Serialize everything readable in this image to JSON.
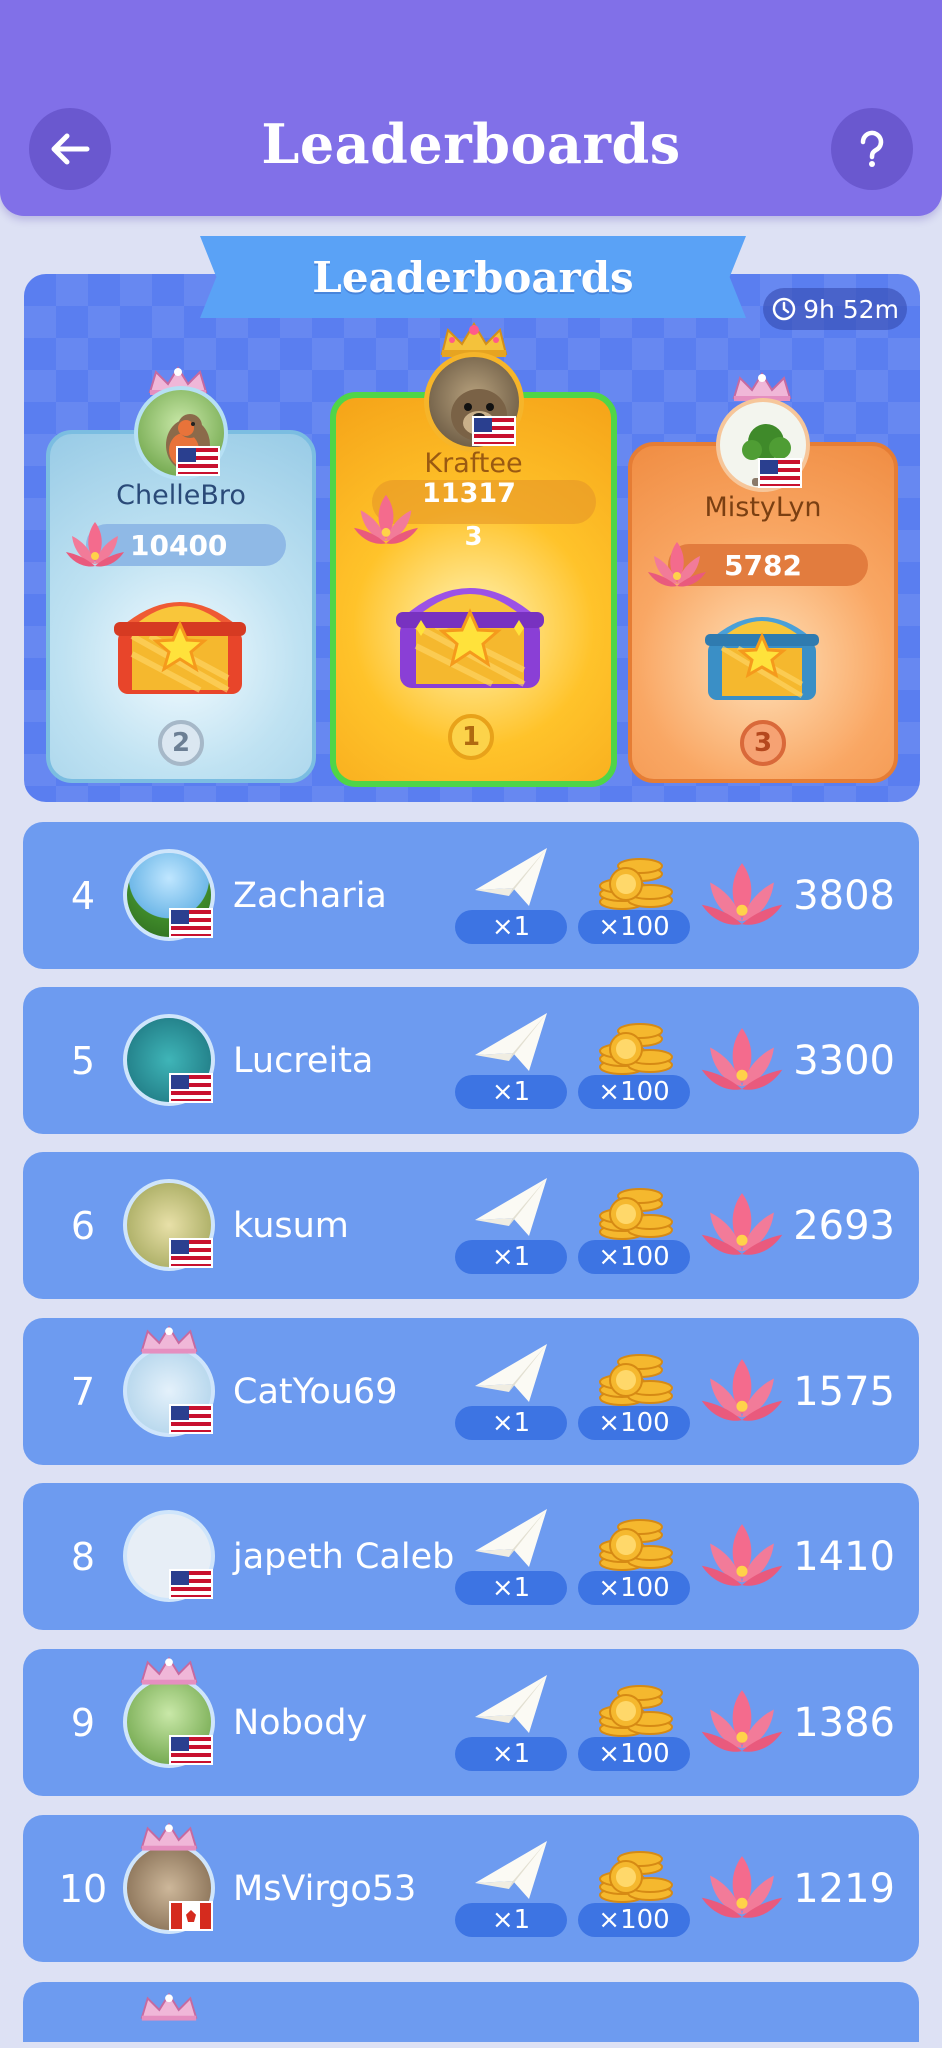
{
  "header": {
    "title": "Leaderboards",
    "back_icon": "arrow-left-icon",
    "help_icon": "question-mark-icon",
    "color": "#8170e8"
  },
  "podium": {
    "banner": "Leaderboards",
    "timer": "9h 52m",
    "first": {
      "rank": "1",
      "name": "Kraftee",
      "score": "11317",
      "sub": "3",
      "flag": "US"
    },
    "second": {
      "rank": "2",
      "name": "ChelleBro",
      "score": "10400",
      "flag": "US"
    },
    "third": {
      "rank": "3",
      "name": "MistyLyn",
      "score": "5782",
      "flag": "US"
    }
  },
  "rows": [
    {
      "rank": "4",
      "name": "Zacharia",
      "plane": "×1",
      "coins": "×100",
      "score": "3808",
      "flag": "US",
      "crown": false
    },
    {
      "rank": "5",
      "name": "Lucreita",
      "plane": "×1",
      "coins": "×100",
      "score": "3300",
      "flag": "US",
      "crown": false
    },
    {
      "rank": "6",
      "name": "kusum",
      "plane": "×1",
      "coins": "×100",
      "score": "2693",
      "flag": "US",
      "crown": false
    },
    {
      "rank": "7",
      "name": "CatYou69",
      "plane": "×1",
      "coins": "×100",
      "score": "1575",
      "flag": "US",
      "crown": true
    },
    {
      "rank": "8",
      "name": "japeth Caleb",
      "plane": "×1",
      "coins": "×100",
      "score": "1410",
      "flag": "US",
      "crown": false
    },
    {
      "rank": "9",
      "name": "Nobody",
      "plane": "×1",
      "coins": "×100",
      "score": "1386",
      "flag": "US",
      "crown": true
    },
    {
      "rank": "10",
      "name": "MsVirgo53",
      "plane": "×1",
      "coins": "×100",
      "score": "1219",
      "flag": "CA",
      "crown": true
    }
  ]
}
